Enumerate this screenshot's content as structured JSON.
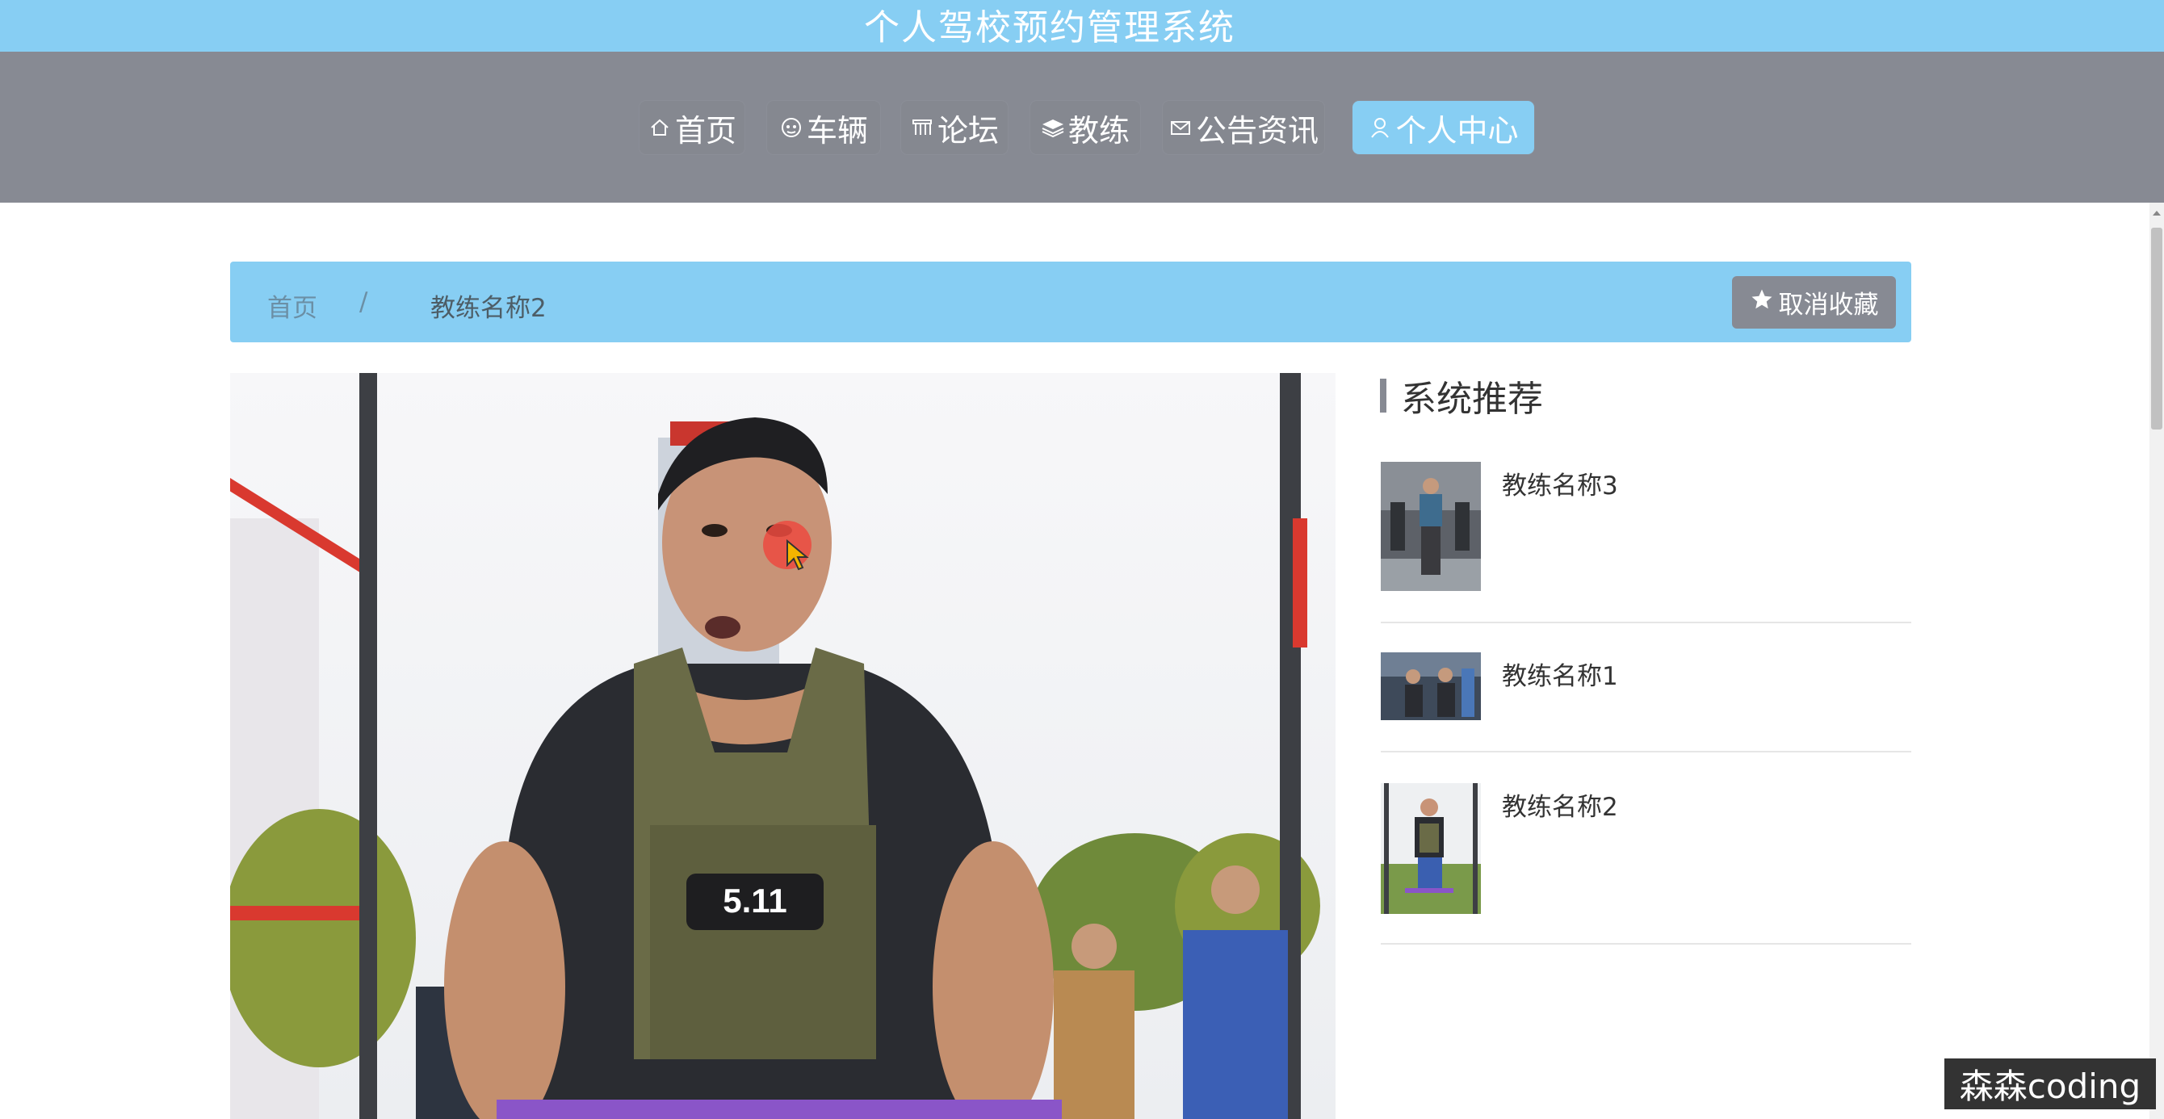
{
  "header": {
    "title": "个人驾校预约管理系统"
  },
  "nav": {
    "items": [
      {
        "label": "首页",
        "icon": "home-icon"
      },
      {
        "label": "车辆",
        "icon": "car-icon"
      },
      {
        "label": "论坛",
        "icon": "forum-icon"
      },
      {
        "label": "教练",
        "icon": "layers-icon"
      },
      {
        "label": "公告资讯",
        "icon": "mail-icon"
      },
      {
        "label": "个人中心",
        "icon": "user-icon",
        "active": true
      }
    ]
  },
  "breadcrumb": {
    "home": "首页",
    "separator": "/",
    "current": "教练名称2"
  },
  "actions": {
    "favorite_label": "取消收藏",
    "favorite_icon": "star-icon"
  },
  "main_image": {
    "badge_text": "5.11"
  },
  "sidebar": {
    "title": "系统推荐",
    "items": [
      {
        "name": "教练名称3"
      },
      {
        "name": "教练名称1"
      },
      {
        "name": "教练名称2"
      }
    ]
  },
  "watermark": "森森coding",
  "colors": {
    "primary": "#87cef3",
    "nav_bg": "#878a93",
    "button_gray": "#878a93"
  }
}
